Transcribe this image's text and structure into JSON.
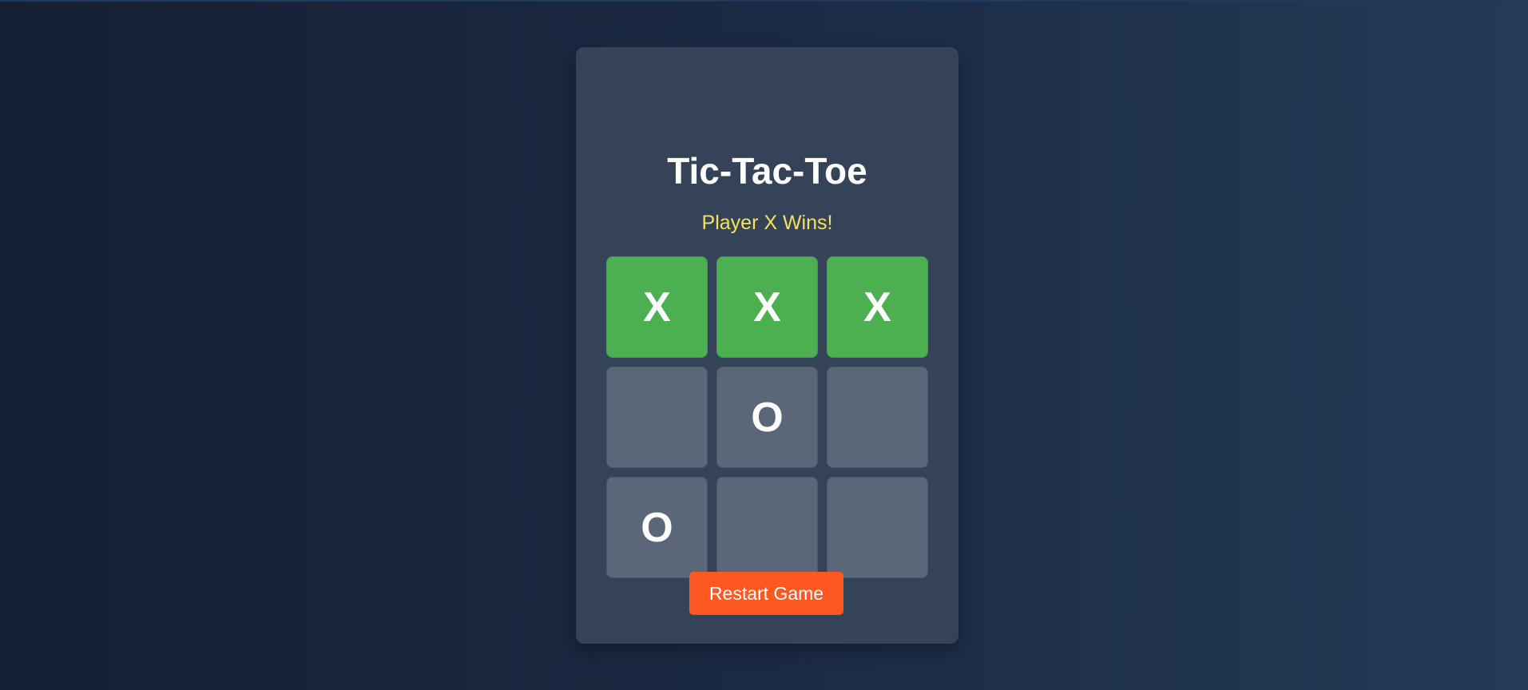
{
  "game": {
    "title": "Tic-Tac-Toe",
    "status": "Player X Wins!",
    "board": [
      {
        "mark": "X",
        "win": true
      },
      {
        "mark": "X",
        "win": true
      },
      {
        "mark": "X",
        "win": true
      },
      {
        "mark": "",
        "win": false
      },
      {
        "mark": "O",
        "win": false
      },
      {
        "mark": "",
        "win": false
      },
      {
        "mark": "O",
        "win": false
      },
      {
        "mark": "",
        "win": false
      },
      {
        "mark": "",
        "win": false
      }
    ],
    "restart_label": "Restart Game"
  },
  "colors": {
    "win_cell": "#4caf50",
    "cell": "#5b6779",
    "status": "#f6e05e",
    "restart_button": "#ff5722",
    "card": "#344358"
  }
}
